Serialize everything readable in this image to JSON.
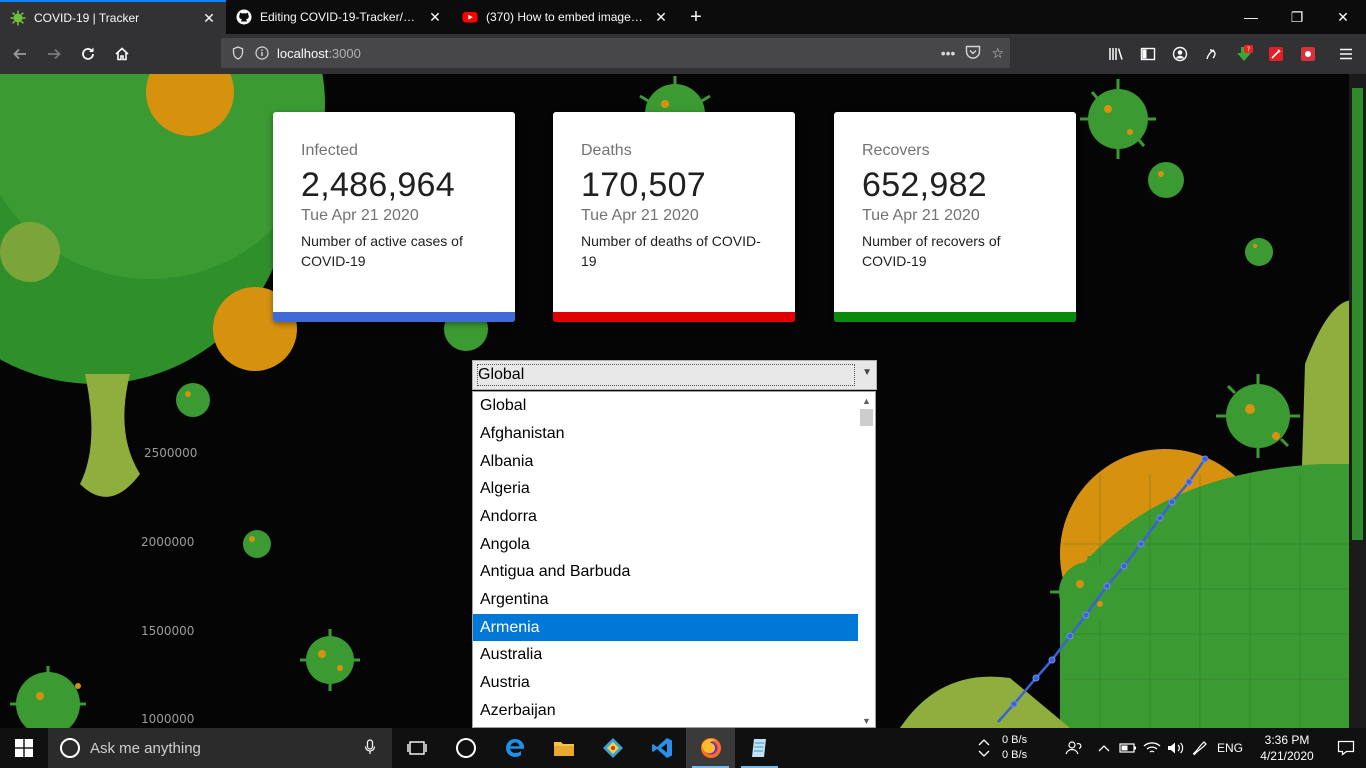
{
  "browser": {
    "tabs": [
      {
        "title": "COVID-19 | Tracker",
        "icon": "virus-icon",
        "active": true
      },
      {
        "title": "Editing COVID-19-Tracker/README.md",
        "icon": "github-icon",
        "active": false
      },
      {
        "title": "(370) How to embed images in",
        "icon": "youtube-icon",
        "active": false
      }
    ],
    "new_tab": "+",
    "url_host": "localhost",
    "url_port": ":3000"
  },
  "cards": [
    {
      "title": "Infected",
      "value": "2,486,964",
      "date": "Tue Apr 21 2020",
      "description": "Number of active cases of COVID-19",
      "color": "#3f69d9"
    },
    {
      "title": "Deaths",
      "value": "170,507",
      "date": "Tue Apr 21 2020",
      "description": "Number of deaths of COVID-19",
      "color": "#e00000"
    },
    {
      "title": "Recovers",
      "value": "652,982",
      "date": "Tue Apr 21 2020",
      "description": "Number of recovers of COVID-19",
      "color": "#0a8a0a"
    }
  ],
  "country_select": {
    "value": "Global",
    "highlighted": "Armenia",
    "options": [
      "Global",
      "Afghanistan",
      "Albania",
      "Algeria",
      "Andorra",
      "Angola",
      "Antigua and Barbuda",
      "Argentina",
      "Armenia",
      "Australia",
      "Austria",
      "Azerbaijan"
    ]
  },
  "chart_axis": {
    "y_ticks": [
      "2500000",
      "2000000",
      "1500000",
      "1000000"
    ],
    "line_color": "#3b63d6"
  },
  "taskbar": {
    "search_placeholder": "Ask me anything",
    "net_up": "0 B/s",
    "net_down": "0 B/s",
    "language": "ENG",
    "time": "3:36 PM",
    "date": "4/21/2020"
  }
}
